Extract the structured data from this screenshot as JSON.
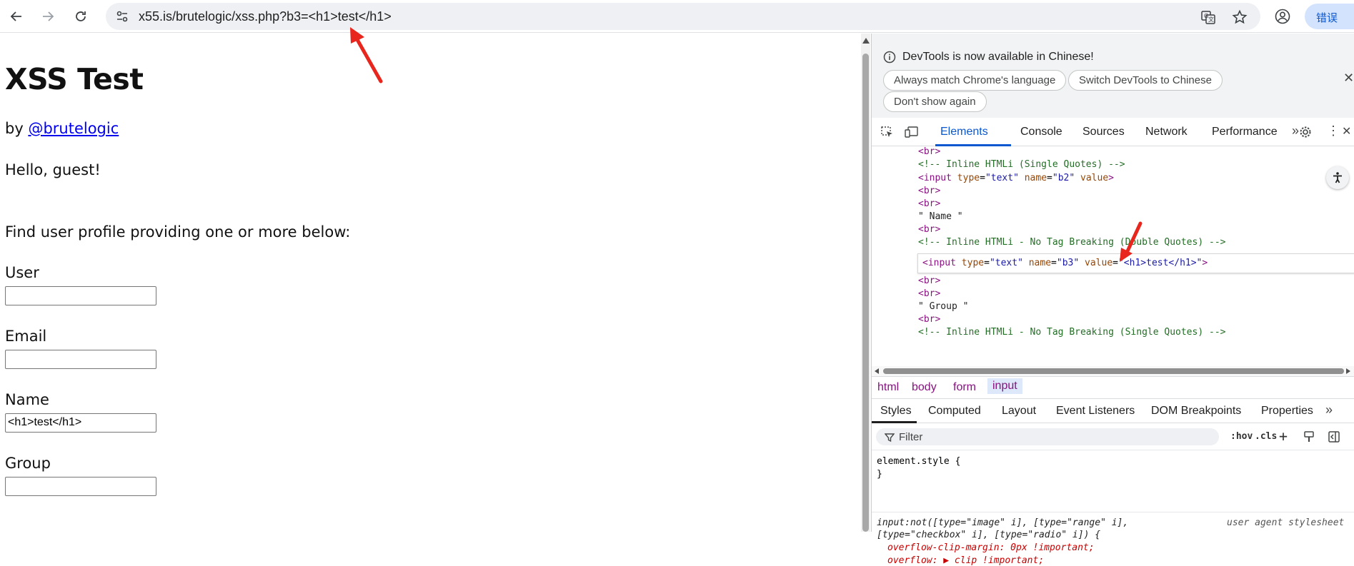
{
  "browser": {
    "url_host": "x55.is",
    "url_path": "/brutelogic/xss.php?b3=<h1>test</h1>",
    "error_label": "错误"
  },
  "page": {
    "title": "XSS Test",
    "by_prefix": "by ",
    "by_link": "@brutelogic",
    "greeting": "Hello, guest!",
    "instruction": "Find user profile providing one or more below:",
    "fields": [
      {
        "label": "User",
        "value": ""
      },
      {
        "label": "Email",
        "value": ""
      },
      {
        "label": "Name",
        "value": "<h1>test</h1>"
      },
      {
        "label": "Group",
        "value": ""
      }
    ]
  },
  "devtools": {
    "info_message": "DevTools is now available in Chinese!",
    "info_buttons": [
      "Always match Chrome's language",
      "Switch DevTools to Chinese",
      "Don't show again"
    ],
    "tabs": [
      "Elements",
      "Console",
      "Sources",
      "Network",
      "Performance"
    ],
    "active_tab": "Elements",
    "dom": {
      "br": "<br>",
      "comment_single": "<!-- Inline HTMLi (Single Quotes) -->",
      "input_b2_open": "<input",
      "attr_type": "type",
      "val_text": "\"text\"",
      "attr_name": "name",
      "val_b2": "\"b2\"",
      "attr_value": "value",
      "close_gt": ">",
      "name_text": "\" Name \"",
      "comment_double": "<!-- Inline HTMLi - No Tag Breaking (Double Quotes) -->",
      "input_b3_open": "<input",
      "val_b3": "\"b3\"",
      "val_h1": "\"<h1>test</h1>\"",
      "group_text": "\" Group \"",
      "comment_single_nb": "<!-- Inline HTMLi - No Tag Breaking (Single Quotes) -->"
    },
    "breadcrumbs": [
      "html",
      "body",
      "form",
      "input"
    ],
    "style_tabs": [
      "Styles",
      "Computed",
      "Layout",
      "Event Listeners",
      "DOM Breakpoints",
      "Properties"
    ],
    "filter_placeholder": "Filter",
    "hov_label": ":hov",
    "cls_label": ".cls",
    "styles": {
      "element_style": "element.style {",
      "close_brace": "}",
      "ua_label": "user agent stylesheet",
      "selector_1": "input:not([type=\"image\" i], [type=\"range\" i],",
      "selector_2": "[type=\"checkbox\" i], [type=\"radio\" i]) {",
      "prop_1": "overflow-clip-margin: 0px !important;",
      "prop_2": "overflow: ▶ clip !important;"
    }
  },
  "colors": {
    "accent": "#0b57d0",
    "annotation_red": "#e8261d"
  }
}
